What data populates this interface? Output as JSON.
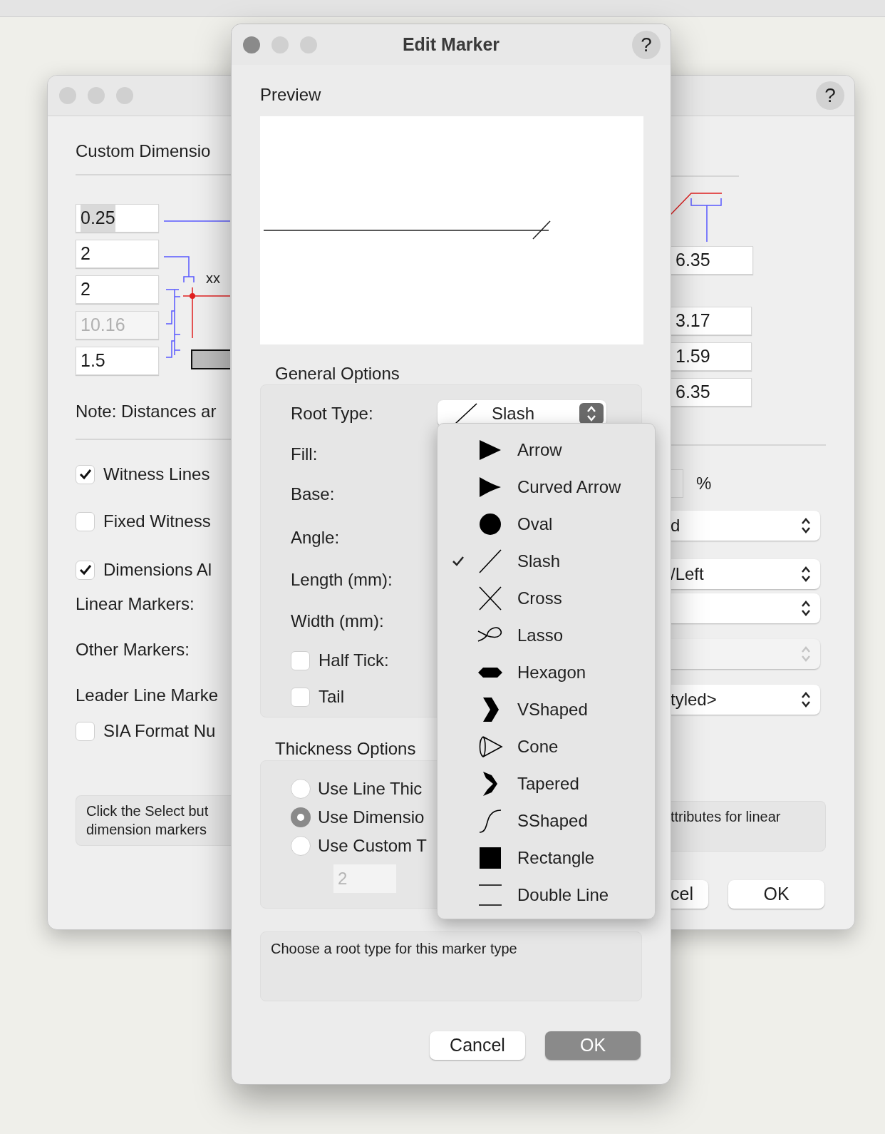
{
  "back_dialog": {
    "help": "?",
    "heading": "Custom Dimensio",
    "left_fields": [
      {
        "value": "0.25",
        "disabled": false,
        "highlighted": true
      },
      {
        "value": "2",
        "disabled": false,
        "highlighted": false
      },
      {
        "value": "2",
        "disabled": false,
        "highlighted": false
      },
      {
        "value": "10.16",
        "disabled": true,
        "highlighted": false
      },
      {
        "value": "1.5",
        "disabled": false,
        "highlighted": false
      }
    ],
    "diagram_label": "xx",
    "note": "Note: Distances ar",
    "checkboxes": [
      {
        "label": "Witness Lines",
        "checked": true
      },
      {
        "label": "Fixed Witness",
        "checked": false
      },
      {
        "label": "Dimensions Al",
        "checked": true
      }
    ],
    "marker_labels": [
      "Linear Markers:",
      "Other Markers:",
      "Leader Line Marke"
    ],
    "sia_checkbox": {
      "label": "SIA Format Nu",
      "checked": false
    },
    "info_left": [
      "Click the Select but",
      "dimension markers"
    ],
    "right_fields": [
      {
        "value": "6.35"
      },
      {
        "value": "3.17"
      },
      {
        "value": "1.59"
      },
      {
        "value": "6.35"
      }
    ],
    "percent_label": "%",
    "popups": [
      {
        "value": "d",
        "disabled": false
      },
      {
        "value": "/Left",
        "disabled": false
      },
      {
        "disabled": false
      },
      {
        "disabled": true
      },
      {
        "value": "tyled>",
        "disabled": false
      }
    ],
    "info_right": "ttributes for linear",
    "buttons": [
      {
        "label": "cel",
        "default": false
      },
      {
        "label": "OK",
        "default": false
      }
    ]
  },
  "edit_marker": {
    "title": "Edit Marker",
    "help": "?",
    "preview_label": "Preview",
    "general_title": "General Options",
    "root_type_label": "Root Type:",
    "root_type_value": "Slash",
    "labels": [
      "Fill:",
      "Base:",
      "Angle:",
      "Length (mm):",
      "Width (mm):"
    ],
    "checkboxes": [
      {
        "label": "Half Tick:",
        "checked": false
      },
      {
        "label": "Tail",
        "checked": false
      }
    ],
    "thickness_title": "Thickness Options",
    "radios": [
      {
        "label": "Use Line Thic",
        "selected": false
      },
      {
        "label": "Use Dimensio",
        "selected": true
      },
      {
        "label": "Use Custom T",
        "selected": false
      }
    ],
    "custom_value": {
      "value": "2",
      "disabled": true
    },
    "info": "Choose a root type for this marker type",
    "buttons": [
      {
        "label": "Cancel",
        "default": false
      },
      {
        "label": "OK",
        "default": true
      }
    ],
    "menu": [
      {
        "label": "Arrow",
        "selected": false
      },
      {
        "label": "Curved Arrow",
        "selected": false
      },
      {
        "label": "Oval",
        "selected": false
      },
      {
        "label": "Slash",
        "selected": true
      },
      {
        "label": "Cross",
        "selected": false
      },
      {
        "label": "Lasso",
        "selected": false
      },
      {
        "label": "Hexagon",
        "selected": false
      },
      {
        "label": "VShaped",
        "selected": false
      },
      {
        "label": "Cone",
        "selected": false
      },
      {
        "label": "Tapered",
        "selected": false
      },
      {
        "label": "SShaped",
        "selected": false
      },
      {
        "label": "Rectangle",
        "selected": false
      },
      {
        "label": "Double Line",
        "selected": false
      }
    ]
  }
}
